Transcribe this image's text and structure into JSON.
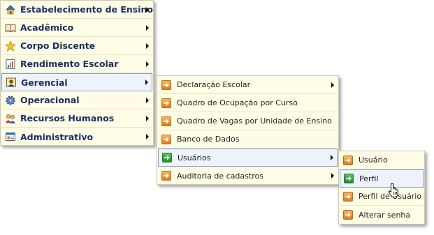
{
  "main_menu": {
    "items": [
      {
        "label": "Estabelecimento de Ensino",
        "icon": "house-icon"
      },
      {
        "label": "Acadêmico",
        "icon": "book-icon"
      },
      {
        "label": "Corpo Discente",
        "icon": "star-icon"
      },
      {
        "label": "Rendimento Escolar",
        "icon": "report-icon"
      },
      {
        "label": "Gerencial",
        "icon": "manager-icon"
      },
      {
        "label": "Operacional",
        "icon": "gear-icon"
      },
      {
        "label": "Recursos Humanos",
        "icon": "people-icon"
      },
      {
        "label": "Administrativo",
        "icon": "window-icon"
      }
    ],
    "highlighted": "Gerencial"
  },
  "gerencial_menu": {
    "items": [
      {
        "label": "Declaração Escolar"
      },
      {
        "label": "Quadro de Ocupação por Curso"
      },
      {
        "label": "Quadro de Vagas por Unidade de Ensino"
      },
      {
        "label": "Banco de Dados"
      },
      {
        "label": "Usuários"
      },
      {
        "label": "Auditoria de cadastros"
      }
    ],
    "highlighted": "Usuários"
  },
  "usuarios_menu": {
    "items": [
      {
        "label": "Usuário"
      },
      {
        "label": "Perfil"
      },
      {
        "label": "Perfil de Usuário"
      },
      {
        "label": "Alterar senha"
      }
    ],
    "highlighted": "Perfil"
  },
  "colors": {
    "menu_bg": "#fffde6",
    "highlight_bg": "#eef3fb",
    "highlight_border": "#7f9ec4",
    "main_text": "#1b2f66",
    "arrow_orange": "#e07a1c",
    "arrow_green": "#1f8f27"
  }
}
